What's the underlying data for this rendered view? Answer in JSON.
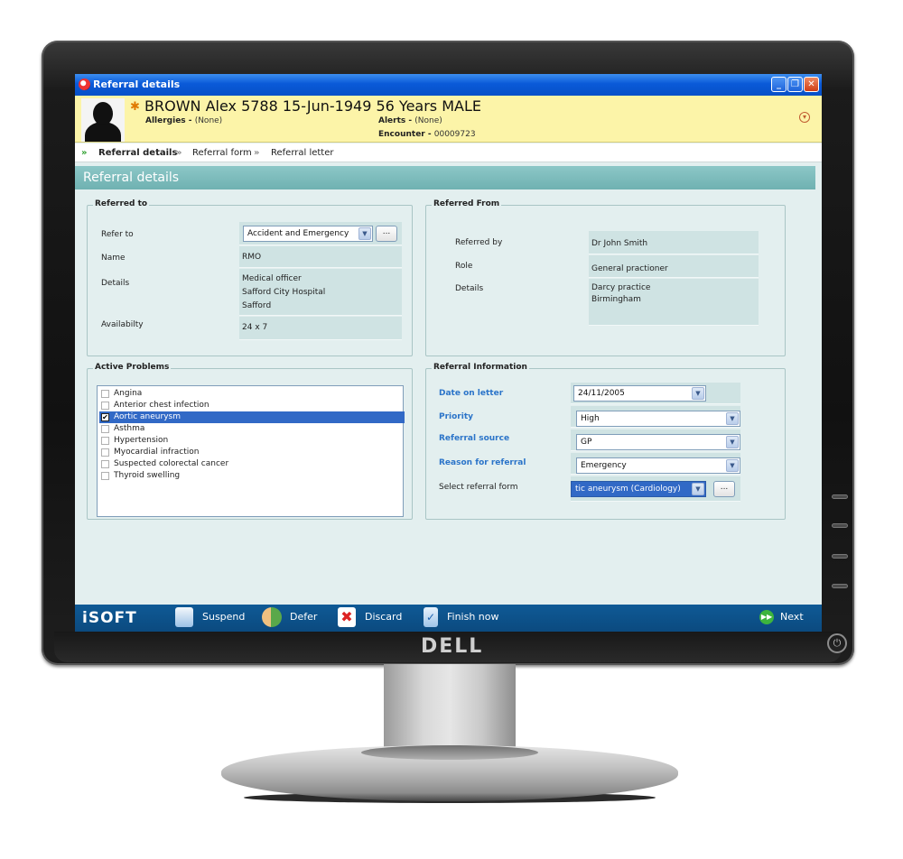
{
  "window": {
    "title": "Referral details"
  },
  "patient": {
    "name_line": "BROWN Alex  5788  15-Jun-1949 56 Years  MALE",
    "allergies_label": "Allergies -",
    "allergies_value": "(None)",
    "alerts_label": "Alerts -",
    "alerts_value": "(None)",
    "encounter_label": "Encounter -",
    "encounter_value": "00009723"
  },
  "breadcrumb": [
    "Referral details",
    "Referral form",
    "Referral letter"
  ],
  "section_title": "Referral details",
  "referred_to": {
    "legend": "Referred to",
    "refer_to_label": "Refer to",
    "refer_to_value": "Accident and Emergency",
    "name_label": "Name",
    "name_value": "RMO",
    "details_label": "Details",
    "details_lines": [
      "Medical officer",
      "Safford City Hospital",
      "Safford"
    ],
    "availability_label": "Availabilty",
    "availability_value": "24 x 7",
    "browse_label": "..."
  },
  "referred_from": {
    "legend": "Referred From",
    "by_label": "Referred by",
    "by_value": "Dr John Smith",
    "role_label": "Role",
    "role_value": "General practioner",
    "details_label": "Details",
    "details_lines": [
      "Darcy practice",
      "Birmingham"
    ]
  },
  "active_problems": {
    "legend": "Active Problems",
    "items": [
      {
        "label": "Angina",
        "checked": false
      },
      {
        "label": "Anterior chest infection",
        "checked": false
      },
      {
        "label": "Aortic aneurysm",
        "checked": true
      },
      {
        "label": "Asthma",
        "checked": false
      },
      {
        "label": "Hypertension",
        "checked": false
      },
      {
        "label": "Myocardial infraction",
        "checked": false
      },
      {
        "label": "Suspected colorectal cancer",
        "checked": false
      },
      {
        "label": "Thyroid swelling",
        "checked": false
      }
    ]
  },
  "referral_info": {
    "legend": "Referral Information",
    "date_label": "Date on letter",
    "date_value": "24/11/2005",
    "priority_label": "Priority",
    "priority_value": "High",
    "source_label": "Referral source",
    "source_value": "GP",
    "reason_label": "Reason for referral",
    "reason_value": "Emergency",
    "form_label": "Select referral form",
    "form_value": "tic aneurysm (Cardiology)",
    "browse_label": "..."
  },
  "taskbar": {
    "logo": "iSOFT",
    "suspend": "Suspend",
    "defer": "Defer",
    "discard": "Discard",
    "finish": "Finish now",
    "next": "Next"
  },
  "monitor": {
    "brand": "DELL"
  },
  "colors": {
    "accent": "#6fb1b1",
    "selection": "#3169c6",
    "banner": "#fcf4a8",
    "taskbar": "#0f5a96"
  }
}
